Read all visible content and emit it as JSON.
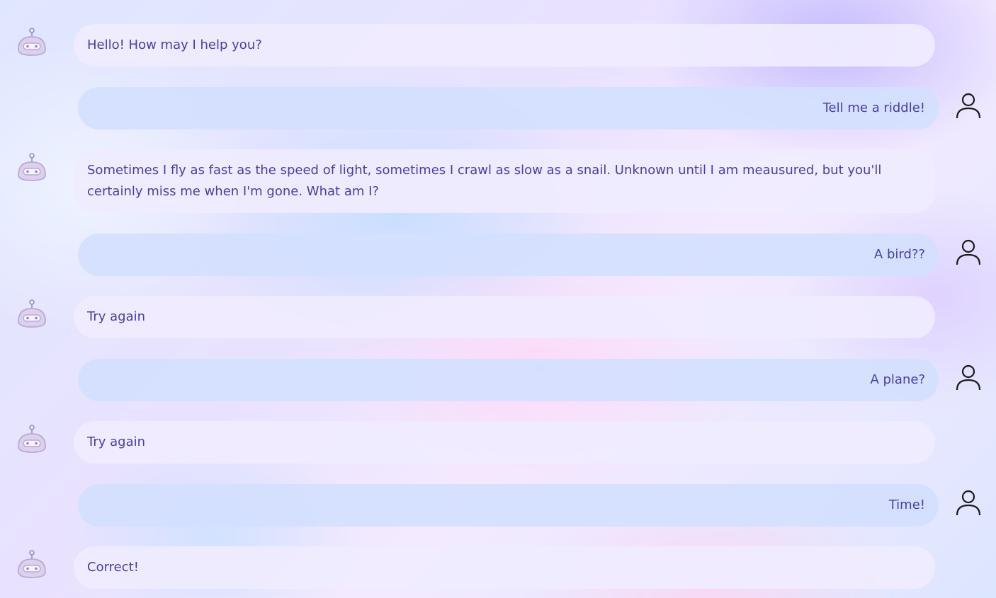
{
  "colors": {
    "bot_bubble": "#f0ecff",
    "user_bubble": "#d4e0ff",
    "text": "#4a3fa3",
    "bot_icon": "#b9a9d9",
    "user_icon": "#1a1a1a"
  },
  "icons": {
    "bot": "robot-icon",
    "user": "user-icon"
  },
  "messages": [
    {
      "role": "bot",
      "text": "Hello! How may I help you?"
    },
    {
      "role": "user",
      "text": "Tell me a riddle!"
    },
    {
      "role": "bot",
      "text": "Sometimes I fly as fast as the speed of light, sometimes I crawl as slow as a snail. Unknown until I am meausured, but you'll certainly miss me when I'm gone. What am I?"
    },
    {
      "role": "user",
      "text": "A bird??"
    },
    {
      "role": "bot",
      "text": "Try again"
    },
    {
      "role": "user",
      "text": "A plane?"
    },
    {
      "role": "bot",
      "text": "Try again"
    },
    {
      "role": "user",
      "text": "Time!"
    },
    {
      "role": "bot",
      "text": "Correct!"
    }
  ]
}
